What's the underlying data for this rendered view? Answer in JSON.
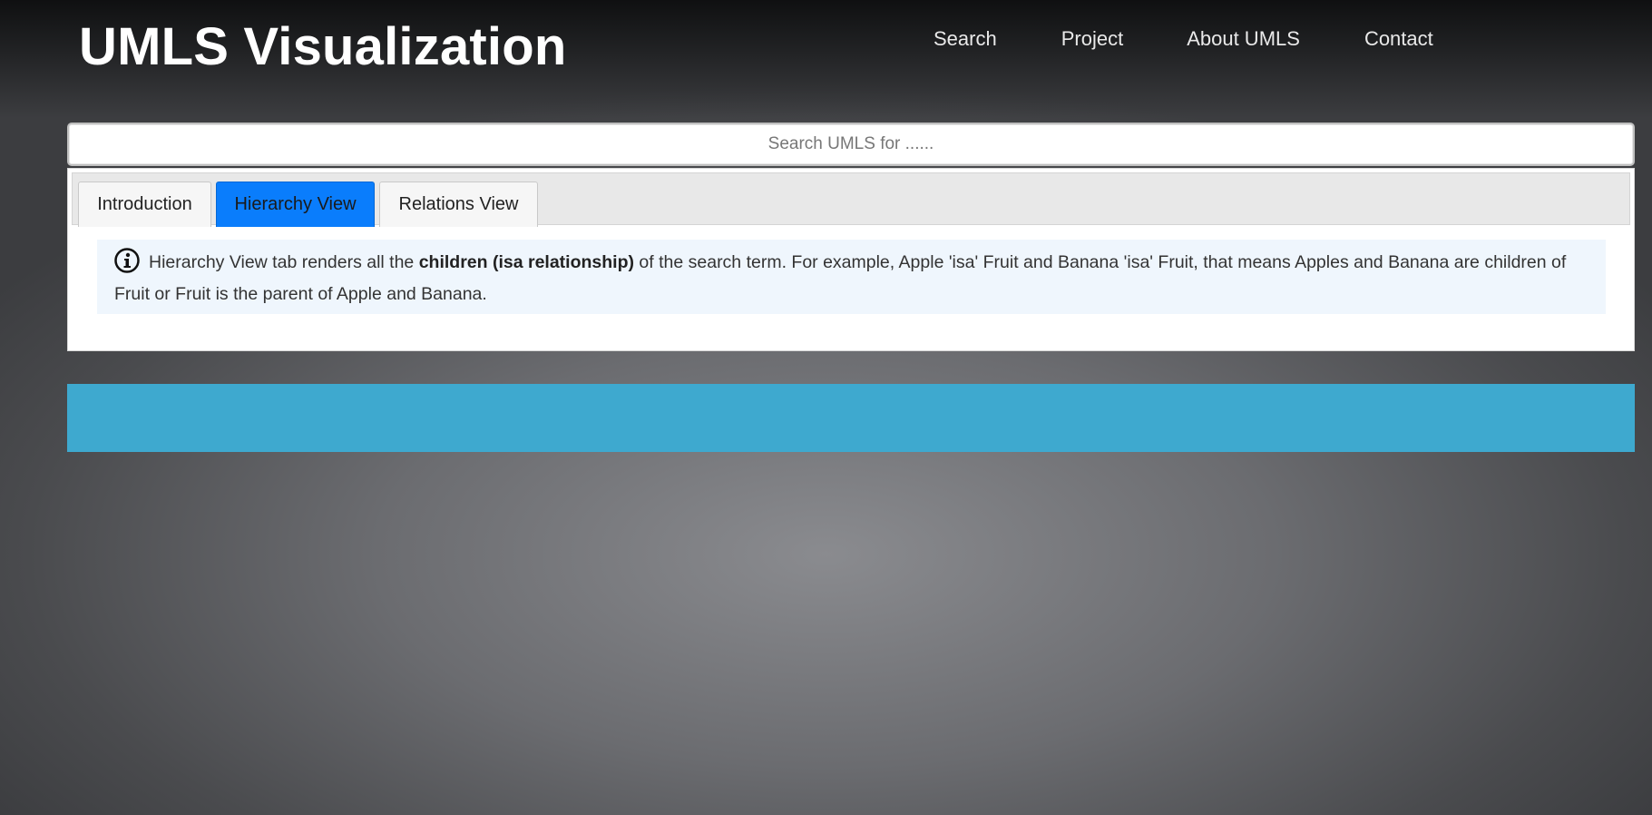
{
  "header": {
    "title": "UMLS Visualization",
    "nav": [
      {
        "label": "Search"
      },
      {
        "label": "Project"
      },
      {
        "label": "About UMLS"
      },
      {
        "label": "Contact"
      }
    ]
  },
  "search": {
    "placeholder": "Search UMLS for ......",
    "value": ""
  },
  "tabs": {
    "items": [
      {
        "label": "Introduction",
        "active": false
      },
      {
        "label": "Hierarchy View",
        "active": true
      },
      {
        "label": "Relations View",
        "active": false
      }
    ],
    "active_color": "#0a7dfc"
  },
  "info": {
    "icon": "info-circle-icon",
    "text_before": "Hierarchy View tab renders all the ",
    "text_bold": "children (isa relationship)",
    "text_after": " of the search term. For example, Apple 'isa' Fruit and Banana 'isa' Fruit, that means Apples and Banana are children of Fruit or Fruit is the parent of Apple and Banana."
  },
  "colors": {
    "banner": "#3ea9cf",
    "info_background": "#eff6fd"
  }
}
